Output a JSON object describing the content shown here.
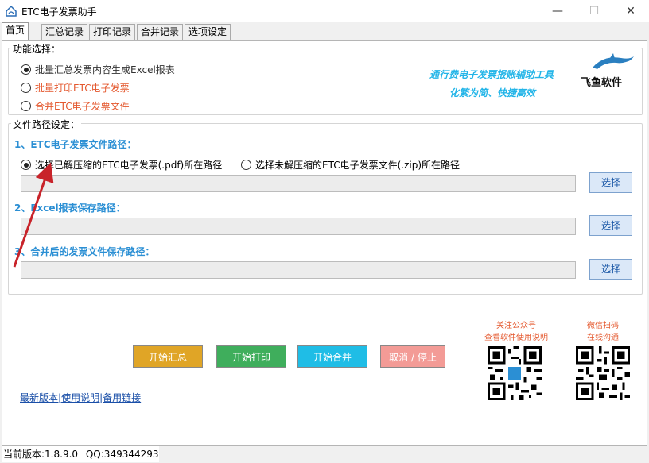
{
  "window": {
    "title": "ETC电子发票助手",
    "minimize": "—",
    "maximize": "☐",
    "close": "✕"
  },
  "tabs": [
    {
      "label": "首页"
    },
    {
      "label": "汇总记录"
    },
    {
      "label": "打印记录"
    },
    {
      "label": "合并记录"
    },
    {
      "label": "选项设定"
    }
  ],
  "function_group": {
    "title": "功能选择：",
    "options": [
      {
        "label": "批量汇总发票内容生成Excel报表",
        "selected": true
      },
      {
        "label": "批量打印ETC电子发票",
        "selected": false
      },
      {
        "label": "合并ETC电子发票文件",
        "selected": false
      }
    ],
    "slogan_line1": "通行费电子发票报账辅助工具",
    "slogan_line2": "化繁为简、快捷高效",
    "brand": "飞鱼软件"
  },
  "path_group": {
    "title": "文件路径设定：",
    "section1_label": "1、ETC电子发票文件路径：",
    "option_pdf": "选择已解压缩的ETC电子发票(.pdf)所在路径",
    "option_zip": "选择未解压缩的ETC电子发票文件(.zip)所在路径",
    "path1_value": "",
    "section2_label": "2、Excel报表保存路径：",
    "path2_value": "",
    "section3_label": "3、合并后的发票文件保存路径：",
    "path3_value": "",
    "select_label": "选择"
  },
  "actions": {
    "start_summary": "开始汇总",
    "start_print": "开始打印",
    "start_merge": "开始合并",
    "cancel_stop": "取消 / 停止"
  },
  "links": {
    "latest": "最新版本",
    "manual": "使用说明",
    "backup": "备用链接",
    "sep": "|"
  },
  "qr1": {
    "line1": "关注公众号",
    "line2": "查看软件使用说明"
  },
  "qr2": {
    "line1": "微信扫码",
    "line2": "在线沟通"
  },
  "status": {
    "version": "当前版本:1.8.9.0",
    "qq": "QQ:349344293"
  },
  "colors": {
    "summary_btn": "#e0a526",
    "print_btn": "#3fae5c",
    "merge_btn": "#1fbde6",
    "cancel_btn": "#f39b96",
    "accent_blue": "#2b8fd4",
    "accent_orange": "#e4582e",
    "arrow_red": "#c8232a"
  }
}
